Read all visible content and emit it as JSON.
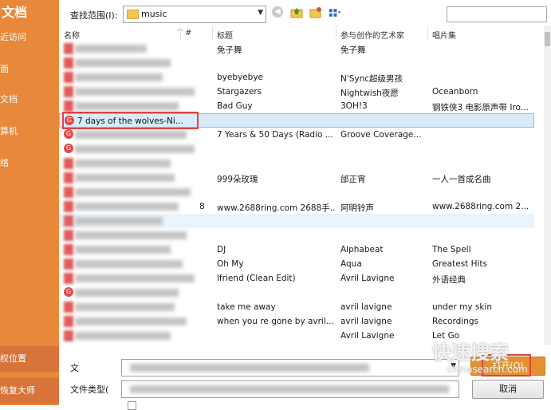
{
  "places": {
    "head": "文档",
    "items": [
      "近访问",
      "面",
      "文档",
      "算机",
      "络"
    ],
    "boxes": [
      "权位置",
      "恢复大师"
    ]
  },
  "toolbar": {
    "look_in_label": "查找范围(I):",
    "look_in_value": "music"
  },
  "columns": {
    "name": "名称",
    "num": "#",
    "title": "标题",
    "artist": "参与创作的艺术家",
    "album": "唱片集"
  },
  "rows": [
    {
      "title": "免子舞",
      "artist": "免子舞",
      "album": ""
    },
    {
      "title": "",
      "artist": "",
      "album": ""
    },
    {
      "title": "byebyebye",
      "artist": "N'Sync超级男孩",
      "album": ""
    },
    {
      "title": "Stargazers",
      "artist": "Nightwish夜愿",
      "album": "Oceanborn"
    },
    {
      "title": "Bad Guy",
      "artist": "3OH!3",
      "album": "钢铁侠3 电影原声带 Iro..."
    },
    {
      "name": "7 days of the wolves-Ni...",
      "title": "",
      "artist": "",
      "album": ""
    },
    {
      "title": "7 Years & 50 Days (Radio ...",
      "artist": "Groove Coverage...",
      "album": ""
    },
    {
      "title": "",
      "artist": "",
      "album": ""
    },
    {
      "title": "",
      "artist": "",
      "album": ""
    },
    {
      "title": "999朵玫瑰",
      "artist": "邰正宵",
      "album": "一人一首成名曲"
    },
    {
      "title": "",
      "artist": "",
      "album": ""
    },
    {
      "num": "8",
      "title": "www.2688ring.com  2688手...",
      "artist": "阿明铃声",
      "album": "www.2688ring.com  2..."
    },
    {
      "title": "",
      "artist": "",
      "album": ""
    },
    {
      "title": "",
      "artist": "",
      "album": ""
    },
    {
      "title": "DJ",
      "artist": "Alphabeat",
      "album": "The Spell"
    },
    {
      "title": "Oh My",
      "artist": "Aqua",
      "album": "Greatest Hits"
    },
    {
      "title": "lfriend (Clean Edit)",
      "artist": "Avril Lavigne",
      "album": "外语经典"
    },
    {
      "title": "",
      "artist": "",
      "album": ""
    },
    {
      "title": "take me away",
      "artist": "avril lavigne",
      "album": "under my skin"
    },
    {
      "title": "when you re gone  by avril...",
      "artist": "avril lavigne",
      "album": "Recordings"
    },
    {
      "title": "",
      "artist": "Avril Lavigne",
      "album": "Let Go"
    }
  ],
  "bottom": {
    "file_name_label": "文",
    "file_type_label": "文件类型(",
    "open_label": "打开(O)",
    "cancel_label": "取消"
  },
  "watermark": {
    "line1": "快速搜索",
    "line2": "chinasearch.com"
  },
  "colors": {
    "accent": "#e8883a",
    "selection": "#d9ebf9",
    "highlight_box": "#e04343"
  }
}
